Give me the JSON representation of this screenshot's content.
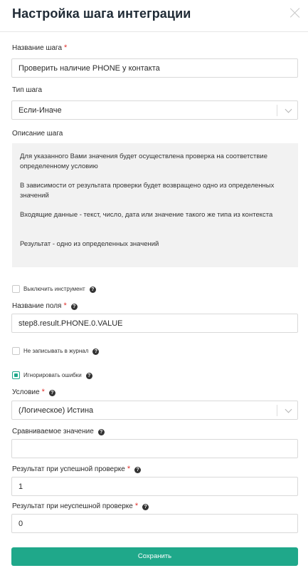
{
  "header": {
    "title": "Настройка шага интеграции"
  },
  "step_name": {
    "label": "Название шага",
    "value": "Проверить наличие PHONE у контакта"
  },
  "step_type": {
    "label": "Тип шага",
    "value": "Если-Иначе"
  },
  "description": {
    "label": "Описание шага",
    "paragraphs": [
      "Для указанного Вами значения будет осуществлена проверка на соответствие определенному условию",
      "В зависимости от результата проверки будет возвращено одно из определенных значений",
      "Входящие данные - текст, число, дата или значение такого же типа из контекста",
      "Результат - одно из определенных значений"
    ]
  },
  "disable_tool": {
    "label": "Выключить инструмент",
    "checked": false
  },
  "field_name": {
    "label": "Название поля",
    "value": "step8.result.PHONE.0.VALUE"
  },
  "no_log": {
    "label": "Не записывать в журнал",
    "checked": false
  },
  "ignore_errors": {
    "label": "Игнорировать ошибки",
    "checked": true
  },
  "condition": {
    "label": "Условие",
    "value": "(Логическое) Истина"
  },
  "compare_value": {
    "label": "Сравниваемое значение",
    "value": ""
  },
  "success_result": {
    "label": "Результат при успешной проверке",
    "value": "1"
  },
  "fail_result": {
    "label": "Результат при неуспешной проверке",
    "value": "0"
  },
  "save_button": {
    "label": "Сохранить"
  },
  "colors": {
    "accent": "#1fa88a",
    "required": "#e0312c"
  }
}
